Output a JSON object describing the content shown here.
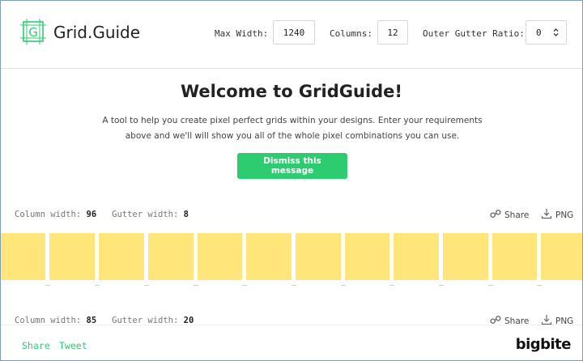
{
  "header": {
    "brand": "Grid.Guide",
    "max_width_label": "Max Width:",
    "max_width_value": "1240",
    "columns_label": "Columns:",
    "columns_value": "12",
    "gutter_ratio_label": "Outer Gutter Ratio:",
    "gutter_ratio_value": "0",
    "logo_letter": "G"
  },
  "welcome": {
    "title": "Welcome to GridGuide!",
    "text_line1": "A tool to help you create pixel perfect grids within your designs. Enter your requirements",
    "text_line2": "above and we'll will show you all of the whole pixel combinations you can use.",
    "dismiss_label": "Dismiss this message"
  },
  "grids": [
    {
      "column_label": "Column width:",
      "column_width": "96",
      "gutter_label": "Gutter width:",
      "gutter_width": "8",
      "share_label": "Share",
      "png_label": "PNG"
    },
    {
      "column_label": "Column width:",
      "column_width": "85",
      "gutter_label": "Gutter width:",
      "gutter_width": "20",
      "share_label": "Share",
      "png_label": "PNG"
    }
  ],
  "footer": {
    "share_label": "Share",
    "tweet_label": "Tweet",
    "company": "bigbite"
  },
  "colors": {
    "accent": "#2ecc71",
    "column_fill": "#ffe57a"
  },
  "icons": [
    "logo-grid-icon",
    "chevron-updown-icon",
    "link-icon",
    "download-icon"
  ]
}
